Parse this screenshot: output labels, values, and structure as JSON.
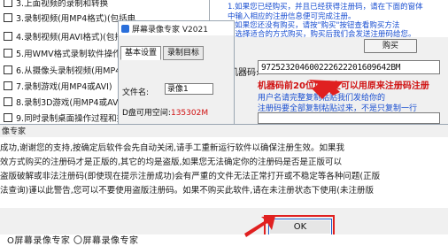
{
  "features": [
    "3.上面视频的录制和转换",
    "3.录制视频(用MP4格式)(包括电",
    "4.录制视频(用AVI格式)(包括电",
    "5.用WMV格式录制软件操作教程等",
    "6.从摄像头录制视频(用MP4或AVI",
    "7.录制游戏(用MP4或AVI)",
    "8.录制3D游戏(用MP4或AVI)",
    "9.同时录制桌面操作过程和摄像"
  ],
  "recorder": {
    "title": "屏幕录像专家 V2021",
    "tabs": [
      "基本设置",
      "录制目标"
    ],
    "file_label": "文件名:",
    "file_value": "录像1",
    "disk_label": "D盘可用空间:",
    "disk_value": "135302M"
  },
  "registration": {
    "lines": [
      "1.如果您已经购买，并且已经获得注册码，请在下面的窗体",
      "中输入相应的注册信息便可完成注册。",
      "2.如果您还没有购买，请按\"购买\"按钮查看购买方法",
      "，选择适合的方式购买，购买后我们会发送注册码给您。"
    ],
    "buy_label": "购买",
    "code_label": "机器码:",
    "machine_code": "97252320460022262220160964​2BM",
    "warning": "机器码前20位如没变可以用原来注册码注册",
    "hint1": "用户名请完整复制粘贴我们发给你的",
    "hint2": "注册码要全部复制粘贴过来，不是只复制一行"
  },
  "dialog": {
    "title": "像专家",
    "lines": [
      "成功,谢谢您的支持,按确定后软件会先自动关闭,请手工重新运行软件以确保注册生效。如果我",
      "效方式购买的注册码才是正版的,其它的均是盗版,如果您无法确定你的注册码是否是正版可以",
      "盗版破解或非法注册码(即使现在提示注册成功)会有严重的文件无法正常打开或不稳定等各种问题(正版",
      "法查询)谨以此警告,您可以不要使用盗版注册码。如果不购买此软件,请在未注册状态下使用(未注册版"
    ],
    "ok_label": "OK"
  },
  "bottom_text": "O屏幕录像专家    〇屏幕录像专家",
  "colors": {
    "link": "#1a4fd1",
    "warning": "#d01010",
    "arrow": "#e02020"
  }
}
